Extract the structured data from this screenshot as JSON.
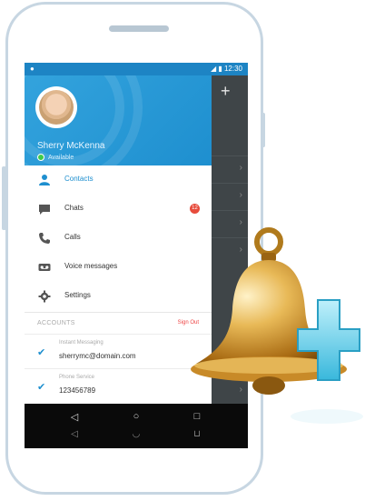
{
  "status_bar": {
    "time": "12:30",
    "signal": "◢",
    "battery": "▮"
  },
  "profile": {
    "name": "Sherry McKenna",
    "status": "Available"
  },
  "menu": [
    {
      "label": "Contacts",
      "icon": "person-icon",
      "glyph": "👤"
    },
    {
      "label": "Chats",
      "icon": "chat-icon",
      "glyph": "▬",
      "badge": "12"
    },
    {
      "label": "Calls",
      "icon": "phone-icon",
      "glyph": "☎"
    },
    {
      "label": "Voice messages",
      "icon": "voicemail-icon",
      "glyph": "◉"
    },
    {
      "label": "Settings",
      "icon": "gear-icon",
      "glyph": "✲"
    }
  ],
  "accounts": {
    "header": "ACCOUNTS",
    "sign_out": "Sign Out",
    "items": [
      {
        "type": "Instant Messaging",
        "value": "sherrymc@domain.com"
      },
      {
        "type": "Phone Service",
        "value": "123456789"
      }
    ]
  },
  "right_panel": {
    "add": "+",
    "chevron": "›"
  },
  "nav": {
    "back": "◁",
    "home": "○",
    "recents": "□"
  },
  "colors": {
    "accent": "#1e8fcf",
    "badge": "#e74c3c",
    "bell": "#d6a23e",
    "plus": "#6fd0ea"
  }
}
